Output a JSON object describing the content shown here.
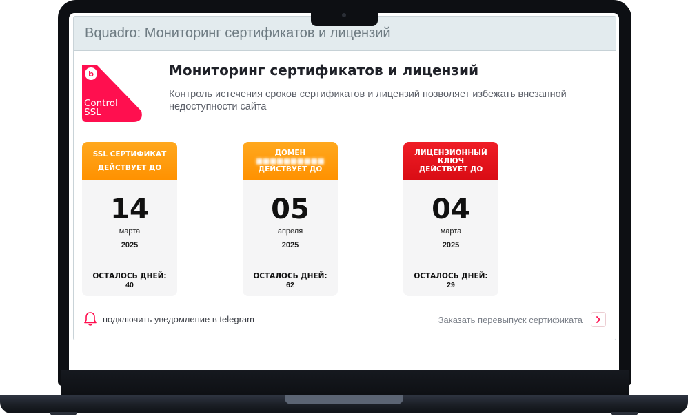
{
  "window": {
    "title": "Bquadro: Мониторинг сертификатов и лицензий"
  },
  "logo": {
    "line1": "Control",
    "line2": "SSL",
    "badge": "b"
  },
  "header": {
    "title": "Мониторинг сертификатов и лицензий",
    "description": "Контроль истечения сроков сертификатов и лицензий позволяет избежать внезапной недоступности сайта"
  },
  "cards": [
    {
      "head1": "SSL СЕРТИФИКАТ",
      "head2": "ДЕЙСТВУЕТ ДО",
      "day": "14",
      "month": "марта",
      "year": "2025",
      "left_label": "ОСТАЛОСЬ ДНЕЙ:",
      "left_count": "40",
      "color": "#ff9b0a"
    },
    {
      "head1": "ДОМЕН",
      "head2": "ДЕЙСТВУЕТ ДО",
      "day": "05",
      "month": "апреля",
      "year": "2025",
      "left_label": "ОСТАЛОСЬ ДНЕЙ:",
      "left_count": "62",
      "color": "#ff9b0a"
    },
    {
      "head1": "ЛИЦЕНЗИОННЫЙ",
      "head1b": "КЛЮЧ",
      "head2": "ДЕЙСТВУЕТ ДО",
      "day": "04",
      "month": "марта",
      "year": "2025",
      "left_label": "ОСТАЛОСЬ ДНЕЙ:",
      "left_count": "29",
      "color": "#e3121b"
    }
  ],
  "footer": {
    "telegram_label": "подключить уведомление в telegram",
    "reissue_label": "Заказать перевыпуск сертификата",
    "bell_icon": "bell-icon",
    "chevron_icon": "chevron-right-icon"
  },
  "colors": {
    "brand": "#ff0f4f",
    "orange": "#ff9b0a",
    "red": "#e3121b"
  }
}
